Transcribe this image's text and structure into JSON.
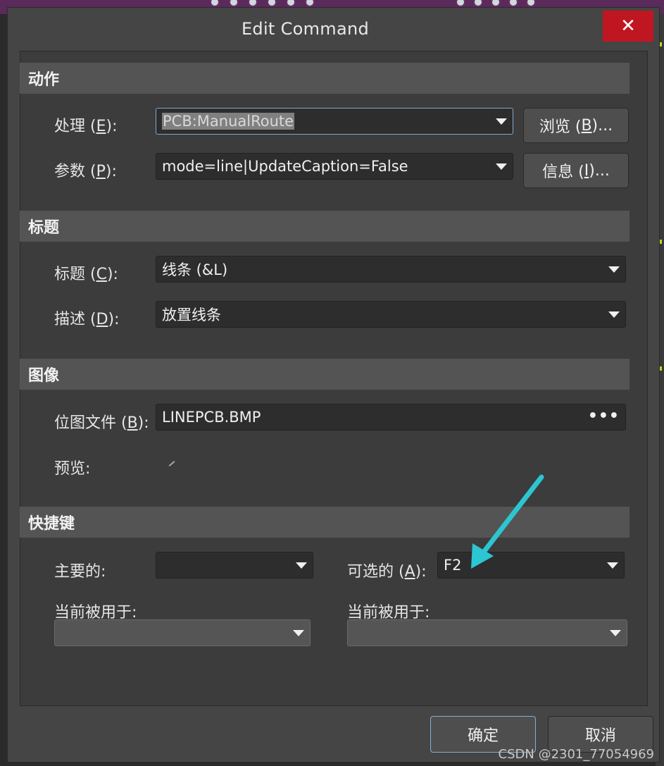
{
  "window": {
    "title": "Edit Command",
    "close_glyph": "✕"
  },
  "sections": {
    "action": {
      "header": "动作",
      "process_label_pre": "处理 (",
      "process_key": "E",
      "process_label_post": "):",
      "process_value": "PCB:ManualRoute",
      "params_label_pre": "参数 (",
      "params_key": "P",
      "params_label_post": "):",
      "params_value": "mode=line|UpdateCaption=False",
      "browse_pre": "浏览 (",
      "browse_key": "B",
      "browse_post": ")...",
      "info_pre": "信息 (",
      "info_key": "I",
      "info_post": ")..."
    },
    "caption": {
      "header": "标题",
      "caption_label_pre": "标题 (",
      "caption_key": "C",
      "caption_label_post": "):",
      "caption_value": "线条 (&L)",
      "desc_label_pre": "描述 (",
      "desc_key": "D",
      "desc_label_post": "):",
      "desc_value": "放置线条"
    },
    "image": {
      "header": "图像",
      "bitmap_label_pre": "位图文件 (",
      "bitmap_key": "B",
      "bitmap_label_post": "):",
      "bitmap_value": "LINEPCB.BMP",
      "ellipsis": "•••",
      "preview_label": "预览:"
    },
    "shortcut": {
      "header": "快捷键",
      "primary_label": "主要的:",
      "primary_value": "",
      "alternate_label_pre": "可选的 (",
      "alternate_key": "A",
      "alternate_label_post": "):",
      "alternate_value": "F2",
      "used_by_left_label": "当前被用于:",
      "used_by_right_label": "当前被用于:"
    }
  },
  "footer": {
    "ok_label": "确定",
    "cancel_label": "取消"
  },
  "watermark": "CSDN @2301_77054969",
  "colors": {
    "close": "#c01622",
    "arrow": "#2cc6d2",
    "focus": "#7fa8c8"
  }
}
